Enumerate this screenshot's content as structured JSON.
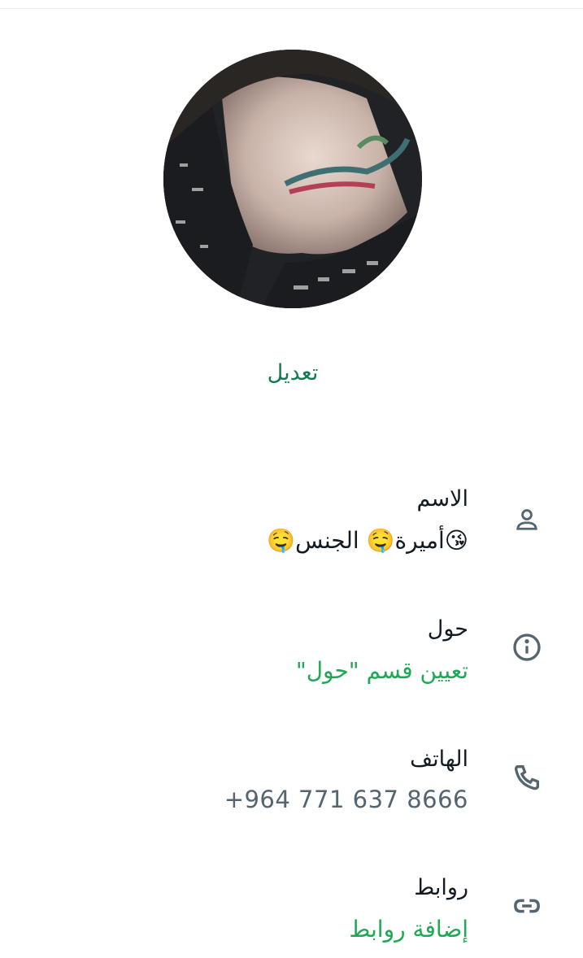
{
  "profile": {
    "edit_label": "تعديل"
  },
  "fields": [
    {
      "title": "الاسم",
      "value": "😘أميرة🤤 الجنس🤤",
      "icon": "person-icon"
    },
    {
      "title": "حول",
      "value": "تعيين قسم \"حول\"",
      "icon": "info-icon"
    },
    {
      "title": "الهاتف",
      "value": "+964 771 637 8666",
      "icon": "phone-icon"
    },
    {
      "title": "روابط",
      "value": "إضافة روابط",
      "icon": "link-icon"
    }
  ],
  "colors": {
    "accent": "#1fa855",
    "edit_text": "#157a4f",
    "icon": "#54656f"
  }
}
